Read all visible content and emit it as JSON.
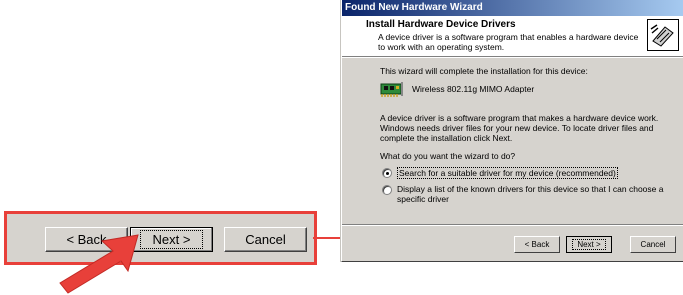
{
  "zoom": {
    "back_label": "< Back",
    "next_label": "Next >",
    "cancel_label": "Cancel"
  },
  "dialog": {
    "title": "Found New Hardware Wizard",
    "header_title": "Install Hardware Device Drivers",
    "header_subtitle": "A device driver is a software program that enables a hardware device to work with an operating system.",
    "intro": "This wizard will complete the installation for this device:",
    "device_name": "Wireless 802.11g MIMO Adapter",
    "description": "A device driver is a software program that makes a hardware device work. Windows needs driver files for your new device. To locate driver files and complete the installation click Next.",
    "question": "What do you want the wizard to do?",
    "options": [
      {
        "label": "Search for a suitable driver for my device (recommended)",
        "selected": true
      },
      {
        "label": "Display a list of the known drivers for this device so that I can choose a specific driver",
        "selected": false
      }
    ],
    "buttons": {
      "back": "< Back",
      "next": "Next >",
      "cancel": "Cancel"
    }
  },
  "colors": {
    "highlight": "#e8403a",
    "titlebar": "#0a246a",
    "face": "#d6d3ce"
  }
}
